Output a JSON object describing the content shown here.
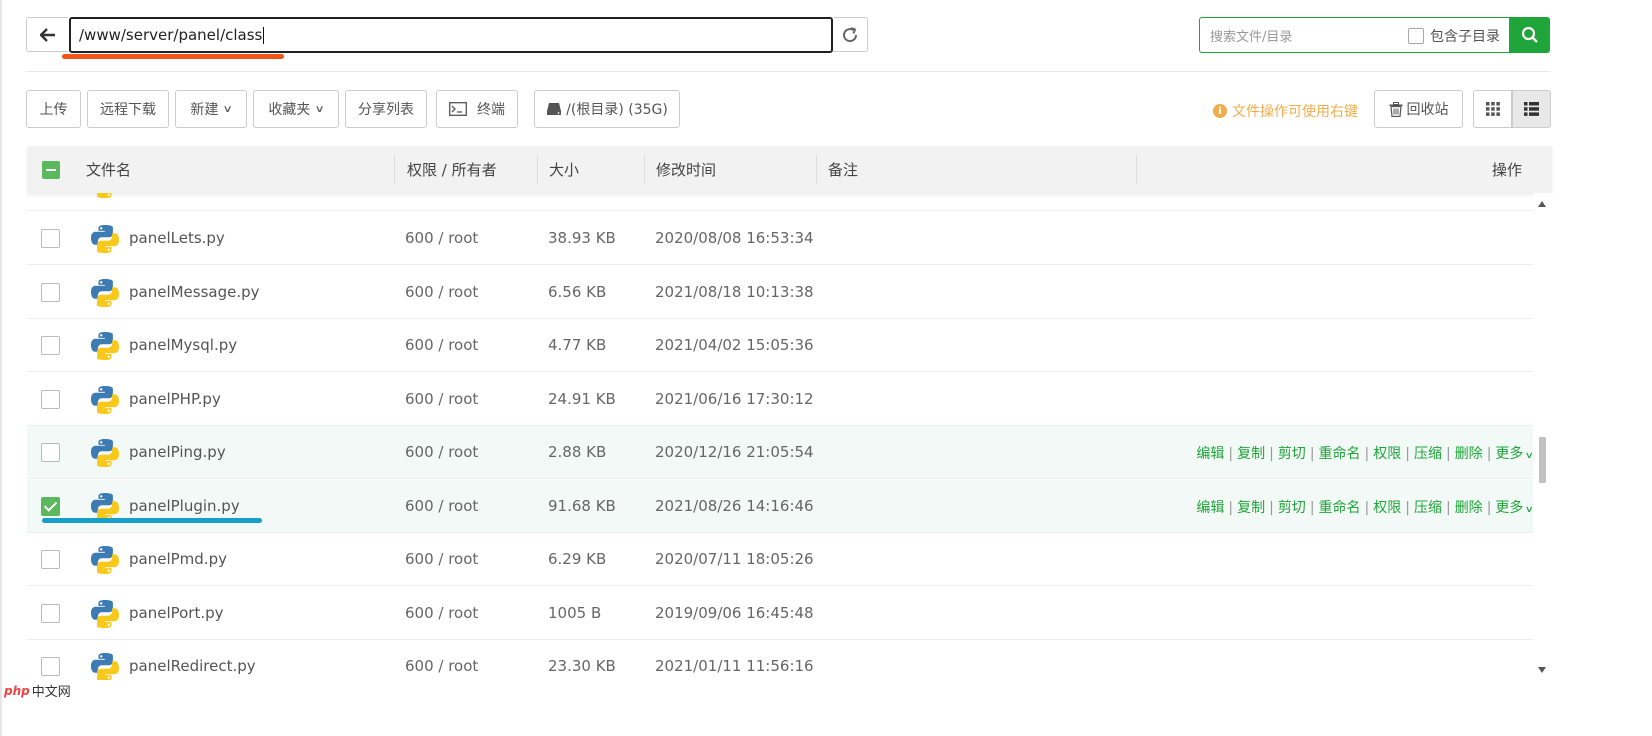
{
  "path_bar": {
    "path": "/www/server/panel/class"
  },
  "search": {
    "placeholder": "搜索文件/目录",
    "subdir_label": "包含子目录"
  },
  "toolbar": {
    "upload": "上传",
    "remote_download": "远程下载",
    "new": "新建",
    "favorites": "收藏夹",
    "share_list": "分享列表",
    "terminal": "终端",
    "disk": "/(根目录) (35G)",
    "tip": "文件操作可使用右键",
    "recycle": "回收站"
  },
  "table": {
    "headers": {
      "name": "文件名",
      "perm": "权限 / 所有者",
      "size": "大小",
      "mtime": "修改时间",
      "note": "备注",
      "ops": "操作"
    },
    "rows": [
      {
        "name": "panelLets.py",
        "perm": "600 / root",
        "size": "38.93 KB",
        "mtime": "2020/08/08 16:53:34",
        "checked": false,
        "hover": false
      },
      {
        "name": "panelMessage.py",
        "perm": "600 / root",
        "size": "6.56 KB",
        "mtime": "2021/08/18 10:13:38",
        "checked": false,
        "hover": false
      },
      {
        "name": "panelMysql.py",
        "perm": "600 / root",
        "size": "4.77 KB",
        "mtime": "2021/04/02 15:05:36",
        "checked": false,
        "hover": false
      },
      {
        "name": "panelPHP.py",
        "perm": "600 / root",
        "size": "24.91 KB",
        "mtime": "2021/06/16 17:30:12",
        "checked": false,
        "hover": false
      },
      {
        "name": "panelPing.py",
        "perm": "600 / root",
        "size": "2.88 KB",
        "mtime": "2020/12/16 21:05:54",
        "checked": false,
        "hover": true
      },
      {
        "name": "panelPlugin.py",
        "perm": "600 / root",
        "size": "91.68 KB",
        "mtime": "2021/08/26 14:16:46",
        "checked": true,
        "hover": true
      },
      {
        "name": "panelPmd.py",
        "perm": "600 / root",
        "size": "6.29 KB",
        "mtime": "2020/07/11 18:05:26",
        "checked": false,
        "hover": false
      },
      {
        "name": "panelPort.py",
        "perm": "600 / root",
        "size": "1005 B",
        "mtime": "2019/09/06 16:45:48",
        "checked": false,
        "hover": false
      },
      {
        "name": "panelRedirect.py",
        "perm": "600 / root",
        "size": "23.30 KB",
        "mtime": "2021/01/11 11:56:16",
        "checked": false,
        "hover": false
      }
    ],
    "row_actions": [
      "编辑",
      "复制",
      "剪切",
      "重命名",
      "权限",
      "压缩",
      "删除",
      "更多"
    ]
  },
  "watermark": {
    "logo": "php",
    "text": "中文网"
  },
  "colors": {
    "accent": "#20a53a",
    "check": "#5cb85c",
    "tip": "#f0ad4e",
    "annotation_red": "#f3541a",
    "annotation_blue": "#14a0c8"
  }
}
